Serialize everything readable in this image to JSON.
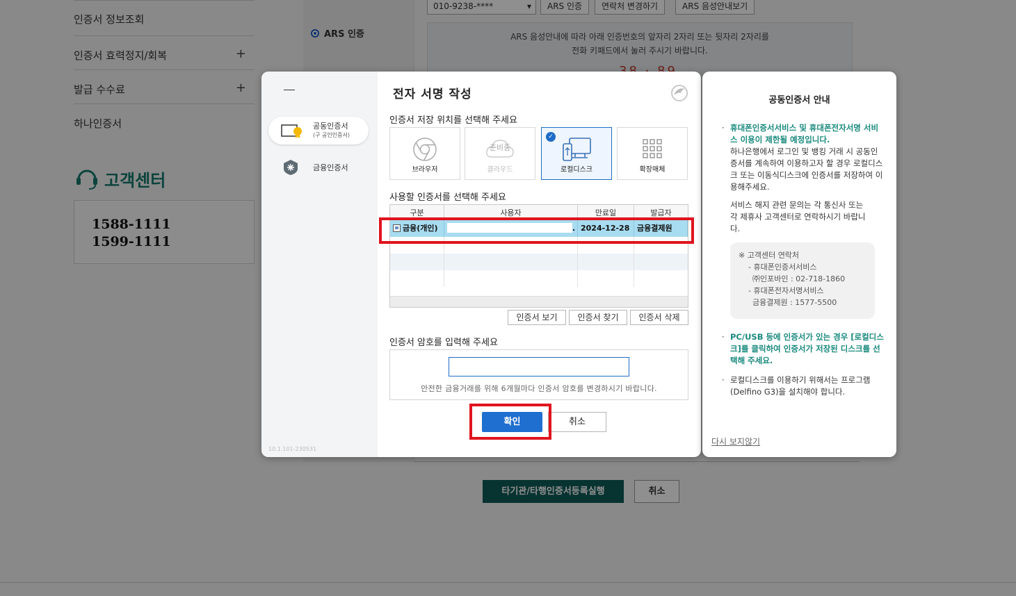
{
  "background": {
    "left_menu": [
      {
        "label": "인증서 정보조회",
        "has_plus": false
      },
      {
        "label": "인증서 효력정지/회복",
        "has_plus": true
      },
      {
        "label": "발급 수수료",
        "has_plus": true
      },
      {
        "label": "하나인증서",
        "has_plus": false
      }
    ],
    "plus_symbol": "+",
    "customer_center": {
      "title": "고객센터",
      "phones": [
        "1588-1111",
        "1599-1111"
      ]
    },
    "radio_label": "ARS 인증",
    "phone_select": "010-9238-****",
    "top_buttons": [
      "ARS 인증",
      "연락처 변경하기",
      "ARS 음성안내보기"
    ],
    "ars_info_line1": "ARS 음성안내에 따라 아래 인증번호의 앞자리 2자리 또는 뒷자리 2자리를",
    "ars_info_line2": "전화 키패드에서 눌러 주시기 바랍니다.",
    "ars_code": "38 · 89",
    "register_button": "타기관/타행인증서등록실행",
    "cancel_button": "취소"
  },
  "dialog": {
    "title": "전자 서명 작성",
    "version": "10.1.101-230531",
    "side_tabs": [
      {
        "label": "공동인증서",
        "sublabel": "(구 공인인증서)",
        "active": true
      },
      {
        "label": "금융인증서",
        "sublabel": "",
        "active": false
      }
    ],
    "storage_label": "인증서 저장 위치를 선택해 주세요",
    "storage_options": [
      {
        "label": "브라우저",
        "icon": "chrome-icon",
        "state": "normal"
      },
      {
        "label": "클라우드",
        "icon": "cloud-icon",
        "state": "disabled",
        "tag": "준비중"
      },
      {
        "label": "로컬디스크",
        "icon": "local-disk-icon",
        "state": "selected"
      },
      {
        "label": "확장매체",
        "icon": "grid-icon",
        "state": "normal"
      }
    ],
    "cert_select_label": "사용할 인증서를 선택해 주세요",
    "table": {
      "headers": [
        "구분",
        "사용자",
        "만료일",
        "발급자"
      ],
      "rows": [
        {
          "type": "금융(개인)",
          "user": ".",
          "expiry": "2024-12-28",
          "issuer": "금융결제원"
        }
      ]
    },
    "cert_buttons": [
      "인증서 보기",
      "인증서 찾기",
      "인증서 삭제"
    ],
    "password_label": "인증서 암호를 입력해 주세요",
    "password_value": "",
    "password_hint": "안전한 금융거래를 위해 6개월마다 인증서 암호를 변경하시기 바랍니다.",
    "ok_button": "확인",
    "cancel_button": "취소"
  },
  "info_panel": {
    "title": "공동인증서 안내",
    "bullet": "·",
    "notice_em": "휴대폰인증서서비스 및 휴대폰전자서명 서비스 이용이 제한될 예정입니다.",
    "notice_body": "하나은행에서 로그인 및 뱅킹 거래 시 공동인증서를 계속하여 이용하고자 할 경우 로컬디스크 또는 이동식디스크에 인증서를 저장하여 이용해주세요.",
    "inquiry": "서비스 해지 관련 문의는 각 통신사 또는 각 제휴사 고객센터로 연락하시기 바랍니다.",
    "contact_title": "※ 고객센터 연락처",
    "contact_1a": "- 휴대폰인증서서비스",
    "contact_1b": "㈜인포바인 : 02-718-1860",
    "contact_2a": "- 휴대폰전자서명서비스",
    "contact_2b": "금융결제원 : 1577-5500",
    "pc_usb_em": "PC/USB 등에 인증서가 있는 경우 [로컬디스크]를 클릭하여 인증서가 저장된 디스크를 선택해 주세요.",
    "local_disk_note": "로컬디스크를 이용하기 위해서는 프로그램(Delfino G3)을 설치해야 합니다.",
    "dont_show": "다시 보지않기"
  },
  "colors": {
    "accent": "#1f6fd1",
    "teal": "#1a8a7e",
    "highlight": "#e0141e",
    "selected_row": "#a8dcf0"
  }
}
